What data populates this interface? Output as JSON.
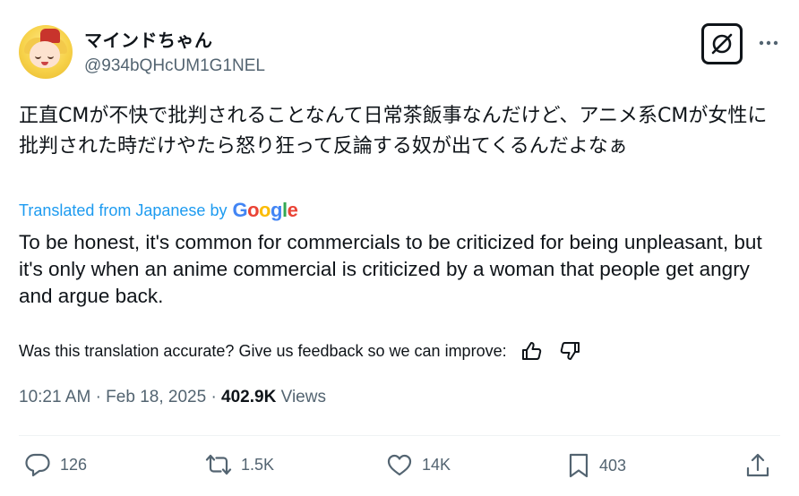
{
  "author": {
    "display_name": "マインドちゃん",
    "handle": "@934bQHcUM1G1NEL"
  },
  "post": {
    "original_text": "正直CMが不快で批判されることなんて日常茶飯事なんだけど、アニメ系CMが女性に批判された時だけやたら怒り狂って反論する奴が出てくるんだよなぁ",
    "translated_by_label": "Translated from Japanese by",
    "translation_provider": "Google",
    "translated_text": "To be honest, it's common for commercials to be criticized for being unpleasant, but it's only when an anime commercial is criticized by a woman that people get angry and argue back.",
    "feedback_prompt": "Was this translation accurate? Give us feedback so we can improve:"
  },
  "meta": {
    "time": "10:21 AM",
    "date": "Feb 18, 2025",
    "views_count": "402.9K",
    "views_label": "Views",
    "separator": "·"
  },
  "actions": {
    "replies": "126",
    "reposts": "1.5K",
    "likes": "14K",
    "bookmarks": "403"
  },
  "icons": {
    "grok": "grok-icon",
    "more": "more-icon",
    "thumbs_up": "thumbs-up-icon",
    "thumbs_down": "thumbs-down-icon",
    "reply": "reply-icon",
    "repost": "repost-icon",
    "like": "heart-icon",
    "bookmark": "bookmark-icon",
    "share": "share-icon"
  },
  "colors": {
    "text": "#0f1419",
    "secondary": "#536471",
    "link": "#1d9bf0",
    "google_blue": "#4285F4",
    "google_red": "#EA4335",
    "google_yellow": "#FBBC05",
    "google_green": "#34A853"
  }
}
